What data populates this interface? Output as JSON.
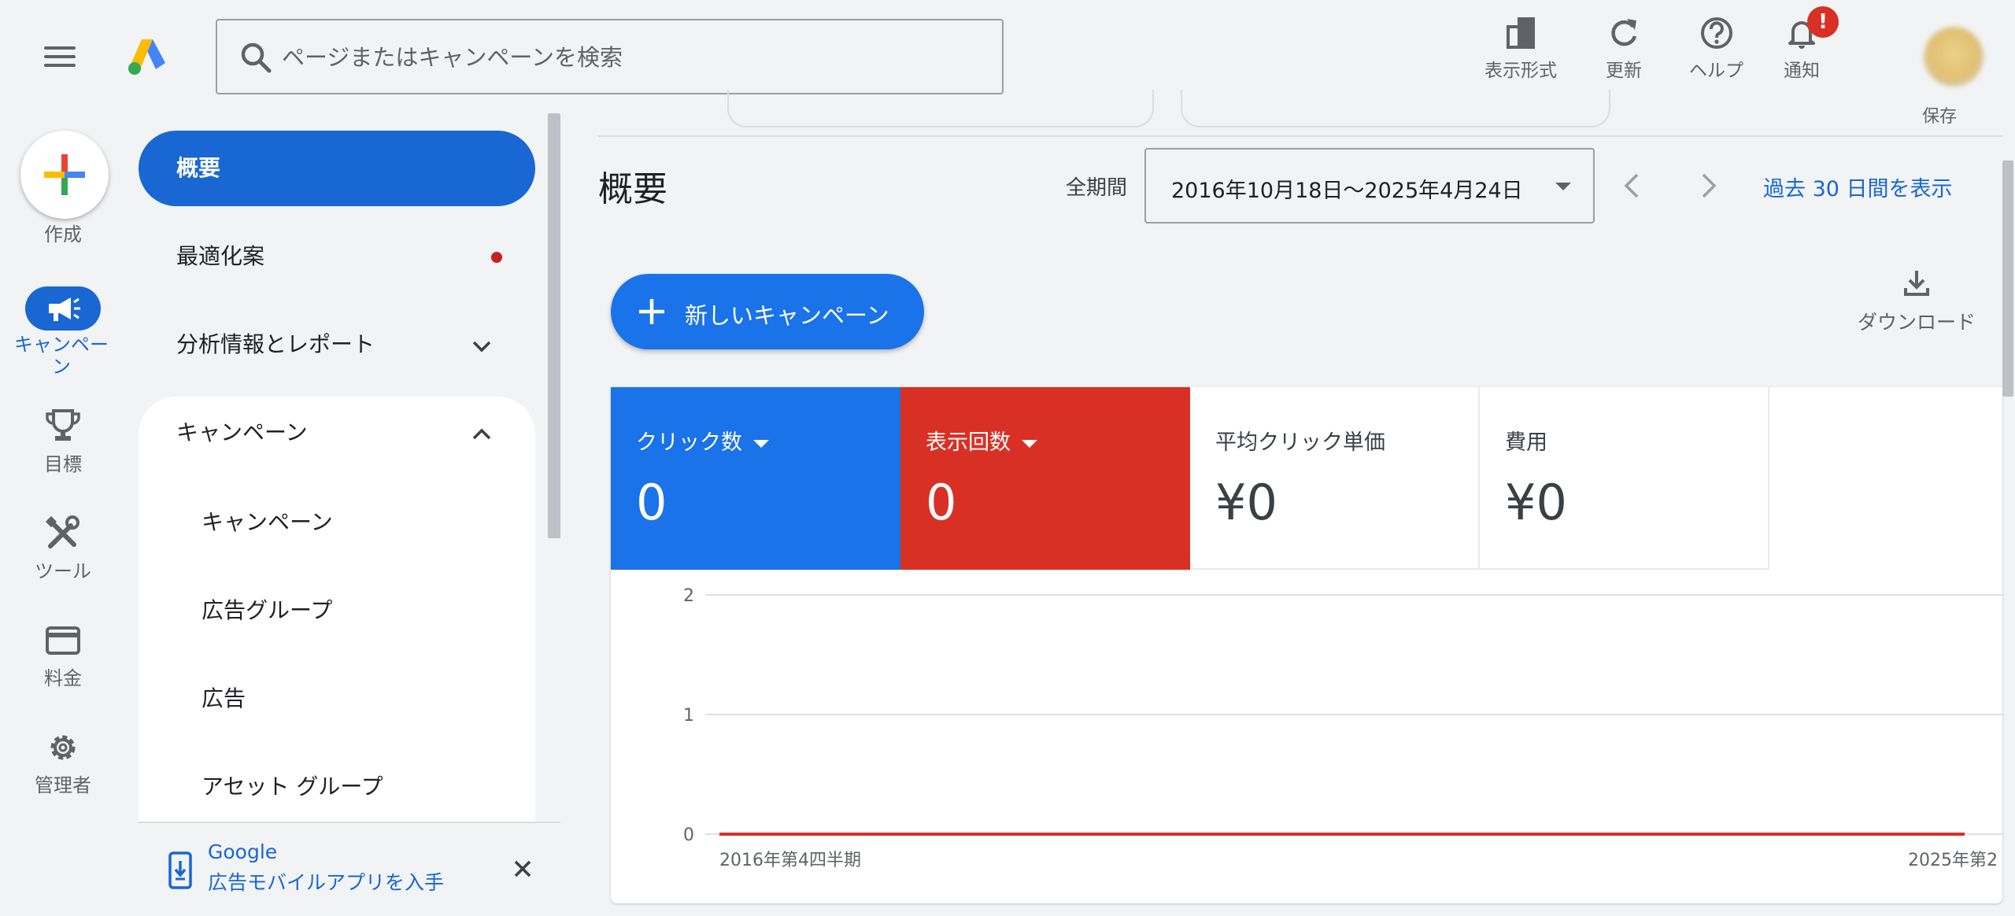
{
  "topbar": {
    "search_placeholder": "ページまたはキャンペーンを検索",
    "buttons": {
      "appearance": "表示形式",
      "refresh": "更新",
      "help": "ヘルプ",
      "notifications": "通知"
    },
    "notification_badge": "!"
  },
  "rail": {
    "create": "作成",
    "campaigns": "キャンペーン",
    "goals": "目標",
    "tools": "ツール",
    "billing": "料金",
    "admin": "管理者"
  },
  "nav": {
    "overview": "概要",
    "recommendations": "最適化案",
    "insights": "分析情報とレポート",
    "campaigns_group": "キャンペーン",
    "sub": {
      "campaigns": "キャンペーン",
      "ad_groups": "広告グループ",
      "ads": "広告",
      "asset_groups": "アセット グループ"
    },
    "promo_line1": "Google",
    "promo_line2": "広告モバイルアプリを入手"
  },
  "main": {
    "strip_text": "保存",
    "title": "概要",
    "period_label": "全期間",
    "date_range": "2016年10月18日～2025年4月24日",
    "show_30_days": "過去 30 日間を表示",
    "new_campaign": "新しいキャンペーン",
    "download": "ダウンロード",
    "metrics": [
      {
        "name": "クリック数",
        "value": "0",
        "color": "#1a73e8"
      },
      {
        "name": "表示回数",
        "value": "0",
        "color": "#d93025"
      },
      {
        "name": "平均クリック単価",
        "value": "¥0"
      },
      {
        "name": "費用",
        "value": "¥0"
      }
    ]
  },
  "colors": {
    "accent": "#1967d2",
    "clicks": "#1a73e8",
    "impressions": "#d93025"
  },
  "chart_data": {
    "type": "line",
    "x": [
      "2016年第4四半期",
      "2025年第2"
    ],
    "series": [
      {
        "values": [
          0,
          0
        ],
        "color": "#1a73e8"
      },
      {
        "values": [
          0,
          0
        ],
        "color": "#d93025"
      }
    ],
    "yticks": [
      "0",
      "1",
      "2"
    ],
    "ylim": [
      0,
      2
    ],
    "grid": true
  }
}
